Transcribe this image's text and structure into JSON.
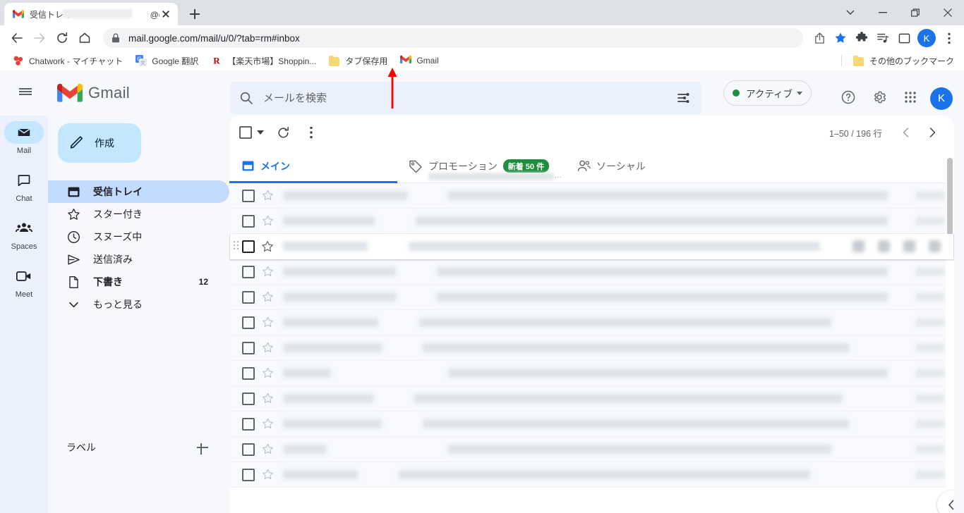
{
  "browser": {
    "tab": {
      "title": "受信トレイ - ",
      "title_suffix": "@gm",
      "favicon": "gmail-icon"
    },
    "new_tab_label": "+",
    "window_controls": [
      "tab-search-chevron",
      "minimize",
      "maximize",
      "close"
    ],
    "address": {
      "url": "mail.google.com/mail/u/0/?tab=rm#inbox",
      "lock": "secure-lock-icon"
    },
    "nav": {
      "back": "back-arrow",
      "forward": "forward-arrow",
      "reload": "reload-icon",
      "home": "home-icon"
    },
    "toolbar_icons": [
      "share-icon",
      "bookmark-star-icon",
      "extensions-puzzle-icon",
      "media-control-icon",
      "side-panel-icon"
    ],
    "profile_initial": "K",
    "menu": "three-dot-menu",
    "bookmarks": [
      {
        "label": "Chatwork - マイチャット",
        "icon": "chatwork-icon"
      },
      {
        "label": "Google 翻訳",
        "icon": "google-translate-icon"
      },
      {
        "label": "【楽天市場】Shoppin...",
        "icon": "rakuten-icon"
      },
      {
        "label": "タブ保存用",
        "icon": "folder-icon"
      },
      {
        "label": "Gmail",
        "icon": "gmail-icon"
      }
    ],
    "other_bookmarks": {
      "label": "その他のブックマーク",
      "icon": "folder-icon"
    }
  },
  "gmail": {
    "hamburger": "main-menu-icon",
    "brand": "Gmail",
    "search": {
      "placeholder": "メールを検索",
      "value": "",
      "icon": "search-icon",
      "options_icon": "search-options-icon"
    },
    "status": {
      "label": "アクティブ",
      "color": "#1e8e3e"
    },
    "header_icons": [
      "help-icon",
      "settings-gear-icon",
      "google-apps-grid-icon"
    ],
    "avatar_initial": "K",
    "rail": [
      {
        "label": "Mail",
        "icon": "mail-icon",
        "active": true
      },
      {
        "label": "Chat",
        "icon": "chat-icon",
        "active": false
      },
      {
        "label": "Spaces",
        "icon": "spaces-icon",
        "active": false
      },
      {
        "label": "Meet",
        "icon": "meet-camera-icon",
        "active": false
      }
    ],
    "compose": {
      "label": "作成",
      "icon": "pencil-icon"
    },
    "nav_items": [
      {
        "label": "受信トレイ",
        "icon": "inbox-icon",
        "count": "",
        "active": true
      },
      {
        "label": "スター付き",
        "icon": "star-icon",
        "count": "",
        "active": false
      },
      {
        "label": "スヌーズ中",
        "icon": "clock-icon",
        "count": "",
        "active": false
      },
      {
        "label": "送信済み",
        "icon": "send-icon",
        "count": "",
        "active": false
      },
      {
        "label": "下書き",
        "icon": "draft-icon",
        "count": "12",
        "active": false,
        "bold": true
      },
      {
        "label": "もっと見る",
        "icon": "chevron-down-icon",
        "count": "",
        "active": false
      }
    ],
    "labels": {
      "title": "ラベル",
      "add": "add-label-plus-icon"
    },
    "list_toolbar": {
      "select_all": "select-all-checkbox",
      "select_dropdown": "select-dropdown-caret",
      "refresh": "refresh-icon",
      "more": "more-options-icon",
      "pagination": "1–50 / 196 行",
      "prev": "previous-page-chevron",
      "next": "next-page-chevron"
    },
    "category_tabs": [
      {
        "label": "メイン",
        "icon": "inbox-tab-icon",
        "active": true,
        "badge": ""
      },
      {
        "label": "プロモーション",
        "icon": "tag-icon",
        "active": false,
        "badge": "新着 50 件"
      },
      {
        "label": "ソーシャル",
        "icon": "people-icon",
        "active": false,
        "badge": ""
      }
    ],
    "email_rows": [
      {
        "redacted": true,
        "hover": false
      },
      {
        "redacted": true,
        "hover": false
      },
      {
        "redacted": true,
        "hover": true
      },
      {
        "redacted": true,
        "hover": false
      },
      {
        "redacted": true,
        "hover": false
      },
      {
        "redacted": true,
        "hover": false
      },
      {
        "redacted": true,
        "hover": false
      },
      {
        "redacted": true,
        "hover": false
      },
      {
        "redacted": true,
        "hover": false
      },
      {
        "redacted": true,
        "hover": false
      },
      {
        "redacted": true,
        "hover": false
      },
      {
        "redacted": true,
        "hover": false
      }
    ],
    "hover_actions": [
      "archive-icon",
      "delete-icon",
      "mark-unread-icon",
      "snooze-icon"
    ],
    "collapse_panel": "collapse-panel-chevron-icon"
  },
  "annotation": {
    "arrow": "red-up-arrow",
    "color": "#ff0000",
    "points_at": "Gmail bookmark"
  }
}
